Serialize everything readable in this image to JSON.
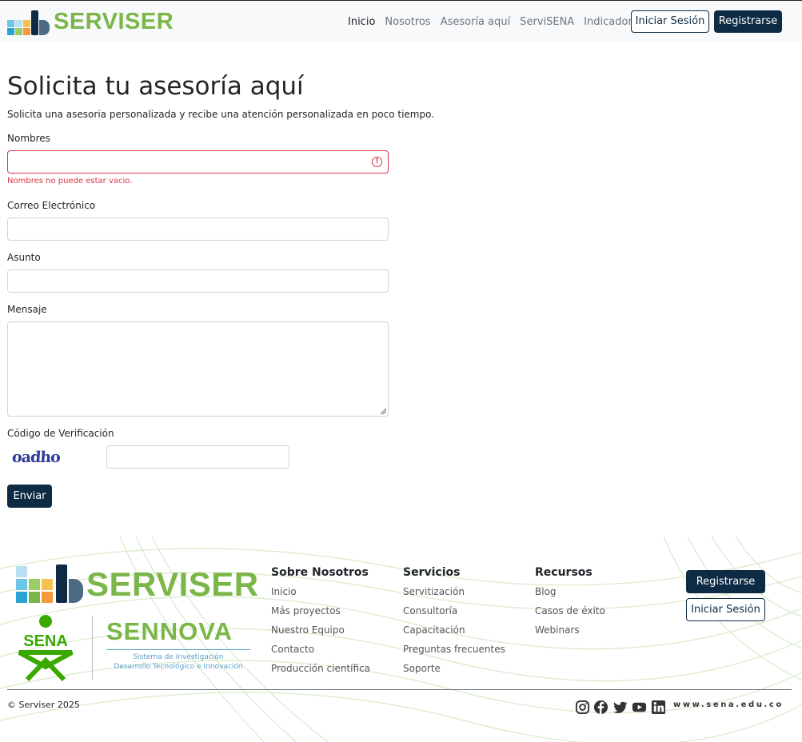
{
  "brand": {
    "name": "SERVISER"
  },
  "nav": {
    "links": [
      "Inicio",
      "Nosotros",
      "Asesoría aquí",
      "ServiSENA",
      "Indicadores"
    ],
    "login_label": "Iniciar Sesión",
    "register_label": "Registrarse"
  },
  "form": {
    "title": "Solicita tu asesoría aquí",
    "subtitle": "Solicita una asesoria personalizada y recibe una atención personalizada en poco tiempo.",
    "name_label": "Nombres",
    "name_value": "",
    "name_error": "Nombres no puede estar vacio.",
    "email_label": "Correo Electrónico",
    "email_value": "",
    "subject_label": "Asunto",
    "subject_value": "",
    "message_label": "Mensaje",
    "message_value": "",
    "captcha_label": "Código de Verificación",
    "captcha_text": "oadho",
    "captcha_value": "",
    "submit_label": "Enviar"
  },
  "footer": {
    "brand": "SERVISER",
    "sena_logo_text": "SENA",
    "sennova_logo_text": "SENNOVA",
    "sennova_tagline_1": "Sistema de Investigación",
    "sennova_tagline_2": "Desarrollo Tecnológico e Innovación",
    "columns": [
      {
        "title": "Sobre Nosotros",
        "links": [
          "Inicio",
          "Más proyectos",
          "Nuestro Equipo",
          "Contacto",
          "Producción científica"
        ]
      },
      {
        "title": "Servicios",
        "links": [
          "Servitización",
          "Consultoría",
          "Capacitación",
          "Preguntas frecuentes",
          "Soporte"
        ]
      },
      {
        "title": "Recursos",
        "links": [
          "Blog",
          "Casos de éxito",
          "Webinars"
        ]
      }
    ],
    "register_label": "Registrarse",
    "login_label": "Iniciar Sesión",
    "copyright": "© Serviser 2025",
    "social_icons": [
      "instagram-icon",
      "facebook-icon",
      "twitter-icon",
      "youtube-icon",
      "linkedin-icon"
    ],
    "sena_url": "www.sena.edu.co"
  },
  "colors": {
    "primary": "#0d2b45",
    "brand_green": "#7ab648",
    "error": "#dc3545"
  }
}
